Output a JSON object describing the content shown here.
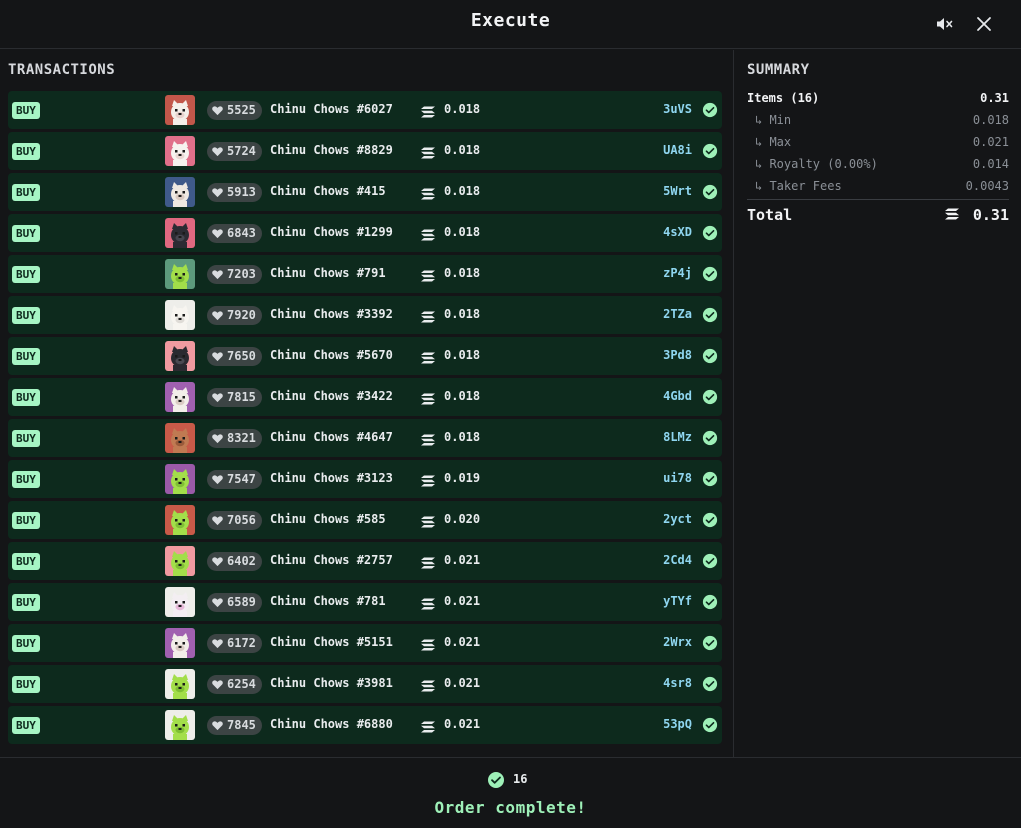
{
  "header": {
    "title": "Execute",
    "mute_icon": "speaker-muted-icon",
    "close_icon": "close-icon"
  },
  "transactions": {
    "title": "TRANSACTIONS",
    "action_label": "BUY",
    "rows": [
      {
        "rank": "5525",
        "name": "Chinu Chows #6027",
        "price": "0.018",
        "tx": "3uVS",
        "img": {
          "bg": "#c2574a",
          "fur": "#f4efe9",
          "face": "#e8d2cc"
        }
      },
      {
        "rank": "5724",
        "name": "Chinu Chows #8829",
        "price": "0.018",
        "tx": "UA8i",
        "img": {
          "bg": "#e0708a",
          "fur": "#f6f2ef",
          "face": "#e9d6d2"
        }
      },
      {
        "rank": "5913",
        "name": "Chinu Chows #415",
        "price": "0.018",
        "tx": "5Wrt",
        "img": {
          "bg": "#3f5a8a",
          "fur": "#efe9e2",
          "face": "#d9c9c0"
        }
      },
      {
        "rank": "6843",
        "name": "Chinu Chows #1299",
        "price": "0.018",
        "tx": "4sXD",
        "img": {
          "bg": "#e06880",
          "fur": "#2b2b33",
          "face": "#45454f"
        }
      },
      {
        "rank": "7203",
        "name": "Chinu Chows #791",
        "price": "0.018",
        "tx": "zP4j",
        "img": {
          "bg": "#5c9a7c",
          "fur": "#a3de4a",
          "face": "#7fbf34"
        }
      },
      {
        "rank": "7920",
        "name": "Chinu Chows #3392",
        "price": "0.018",
        "tx": "2TZa",
        "img": {
          "bg": "#eeeeea",
          "fur": "#f7f5f0",
          "face": "#dedbd6"
        }
      },
      {
        "rank": "7650",
        "name": "Chinu Chows #5670",
        "price": "0.018",
        "tx": "3Pd8",
        "img": {
          "bg": "#f09aa0",
          "fur": "#2a2a30",
          "face": "#4a4a52"
        }
      },
      {
        "rank": "7815",
        "name": "Chinu Chows #3422",
        "price": "0.018",
        "tx": "4Gbd",
        "img": {
          "bg": "#a060b0",
          "fur": "#f2eee9",
          "face": "#dacbc4"
        }
      },
      {
        "rank": "8321",
        "name": "Chinu Chows #4647",
        "price": "0.018",
        "tx": "8LMz",
        "img": {
          "bg": "#c85a48",
          "fur": "#c07a52",
          "face": "#9a5a3a"
        }
      },
      {
        "rank": "7547",
        "name": "Chinu Chows #3123",
        "price": "0.019",
        "tx": "ui78",
        "img": {
          "bg": "#9a5aa8",
          "fur": "#a3de4a",
          "face": "#7fbf34"
        }
      },
      {
        "rank": "7056",
        "name": "Chinu Chows #585",
        "price": "0.020",
        "tx": "2yct",
        "img": {
          "bg": "#c85a48",
          "fur": "#a3de4a",
          "face": "#7fbf34"
        }
      },
      {
        "rank": "6402",
        "name": "Chinu Chows #2757",
        "price": "0.021",
        "tx": "2Cd4",
        "img": {
          "bg": "#f09aa0",
          "fur": "#a3de4a",
          "face": "#7fbf34"
        }
      },
      {
        "rank": "6589",
        "name": "Chinu Chows #781",
        "price": "0.021",
        "tx": "yTYf",
        "img": {
          "bg": "#eeeeea",
          "fur": "#f3eef2",
          "face": "#e6b8d8"
        }
      },
      {
        "rank": "6172",
        "name": "Chinu Chows #5151",
        "price": "0.021",
        "tx": "2Wrx",
        "img": {
          "bg": "#a060b0",
          "fur": "#f2eee9",
          "face": "#dacbc4"
        }
      },
      {
        "rank": "6254",
        "name": "Chinu Chows #3981",
        "price": "0.021",
        "tx": "4sr8",
        "img": {
          "bg": "#eeeeea",
          "fur": "#a3de4a",
          "face": "#7fbf34"
        }
      },
      {
        "rank": "7845",
        "name": "Chinu Chows #6880",
        "price": "0.021",
        "tx": "53pQ",
        "img": {
          "bg": "#eeeeea",
          "fur": "#a3de4a",
          "face": "#7fbf34"
        }
      }
    ]
  },
  "summary": {
    "title": "SUMMARY",
    "items_label": "Items (16)",
    "items_value": "0.31",
    "min_label": "↳ Min",
    "min_value": "0.018",
    "max_label": "↳ Max",
    "max_value": "0.021",
    "royalty_label": "↳ Royalty (0.00%)",
    "royalty_value": "0.014",
    "taker_label": "↳ Taker Fees",
    "taker_value": "0.0043",
    "total_label": "Total",
    "total_value": "0.31"
  },
  "footer": {
    "count": "16",
    "status": "Order complete!"
  },
  "colors": {
    "background": "#141517",
    "row_bg": "#0d2a1d",
    "buy_badge": "#a6f5c4",
    "tx_link": "#8fd6f0",
    "success": "#9ef0b8"
  }
}
